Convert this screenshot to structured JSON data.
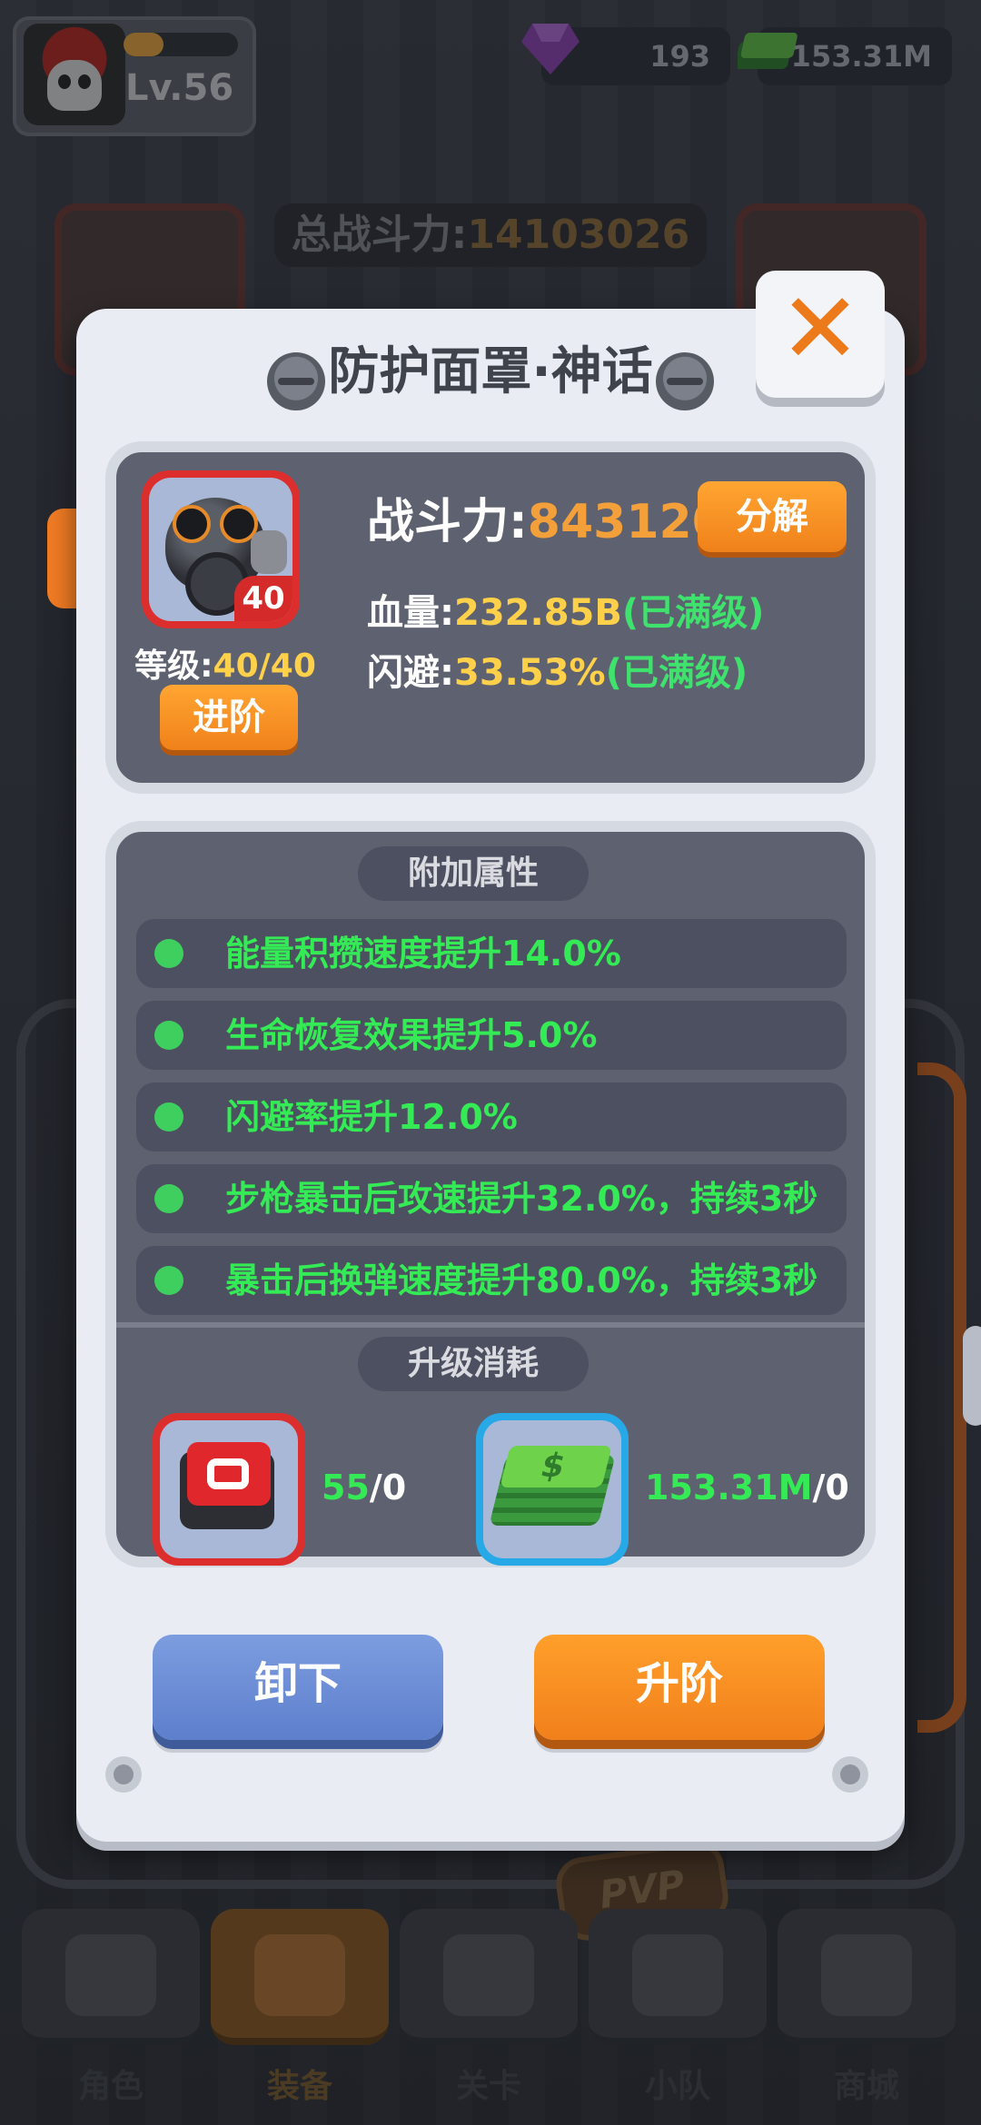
{
  "topbar": {
    "level": "Lv.56",
    "xp_fraction": 0.35,
    "gems": "193",
    "cash": "153.31M"
  },
  "background": {
    "power_label": "总战斗力:",
    "power_value": "14103026"
  },
  "modal": {
    "title": "防护面罩·神话",
    "close_icon": "close-x-icon",
    "item": {
      "icon": "gas-mask-icon",
      "level_badge": "40",
      "grade_label": "等级:",
      "grade_value": "40/40",
      "advance_label": "进阶",
      "power_label": "战斗力:",
      "power_value": "843120",
      "decompose_label": "分解",
      "stats": [
        {
          "label": "血量:",
          "value": "232.85B",
          "note": "(已满级)"
        },
        {
          "label": "闪避:",
          "value": "33.53%",
          "note": "(已满级)"
        }
      ]
    },
    "extra_attrs": {
      "title": "附加属性",
      "items": [
        "能量积攒速度提升14.0%",
        "生命恢复效果提升5.0%",
        "闪避率提升12.0%",
        "步枪暴击后攻速提升32.0%，持续3秒",
        "暴击后换弹速度提升80.0%，持续3秒"
      ]
    },
    "upgrade_cost": {
      "title": "升级消耗",
      "items": [
        {
          "icon": "chip-icon",
          "have": "55",
          "need": "/0"
        },
        {
          "icon": "cash-icon",
          "have": "153.31M",
          "need": "/0"
        }
      ]
    },
    "buttons": {
      "unequip": "卸下",
      "upgrade": "升阶"
    }
  },
  "bottom_nav": {
    "tabs": [
      {
        "label": "角色",
        "icon": "skull-icon",
        "active": false
      },
      {
        "label": "装备",
        "icon": "gun-icon",
        "active": true
      },
      {
        "label": "关卡",
        "icon": "map-icon",
        "active": false
      },
      {
        "label": "小队",
        "icon": "team-icon",
        "active": false
      },
      {
        "label": "商城",
        "icon": "shop-icon",
        "active": false
      }
    ],
    "pvp_label": "PVP"
  },
  "colors": {
    "accent_orange": "#f0811a",
    "stat_yellow": "#ffd04a",
    "attr_green": "#34ea55",
    "panel_bg": "#5e6270"
  }
}
